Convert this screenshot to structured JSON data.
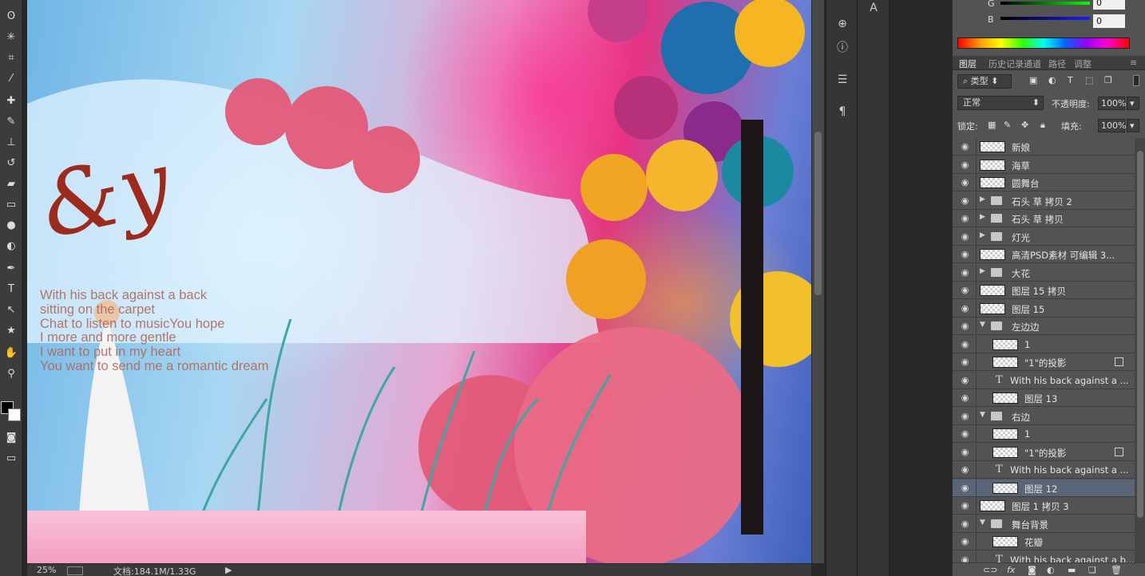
{
  "toolbar": {
    "tools": [
      {
        "name": "lasso-icon",
        "glyph": "ʘ"
      },
      {
        "name": "magic-wand-icon",
        "glyph": "✳"
      },
      {
        "name": "crop-icon",
        "glyph": "⌗"
      },
      {
        "name": "eyedropper-icon",
        "glyph": "⁄"
      },
      {
        "name": "healing-brush-icon",
        "glyph": "✚"
      },
      {
        "name": "brush-icon",
        "glyph": "✎"
      },
      {
        "name": "stamp-icon",
        "glyph": "⊥"
      },
      {
        "name": "history-brush-icon",
        "glyph": "↺"
      },
      {
        "name": "eraser-icon",
        "glyph": "▰"
      },
      {
        "name": "gradient-icon",
        "glyph": "▭"
      },
      {
        "name": "blur-icon",
        "glyph": "●"
      },
      {
        "name": "dodge-icon",
        "glyph": "◐"
      },
      {
        "name": "pen-icon",
        "glyph": "✒"
      },
      {
        "name": "type-icon",
        "glyph": "T"
      },
      {
        "name": "path-select-icon",
        "glyph": "↖"
      },
      {
        "name": "shape-icon",
        "glyph": "★"
      },
      {
        "name": "hand-icon",
        "glyph": "✋"
      },
      {
        "name": "zoom-icon",
        "glyph": "⚲"
      }
    ]
  },
  "canvas": {
    "script_text": "&y",
    "couple_text": [
      "With his back against a back",
      "sitting on the carpet",
      "Chat to listen to musicYou hope",
      " I more and more gentle",
      "I want to put in my heart",
      "You want to send me a romantic dream"
    ]
  },
  "status": {
    "zoom": "25%",
    "doc": "文档:184.1M/1.33G"
  },
  "color_panel": {
    "g_label": "G",
    "g_value": "0",
    "b_label": "B",
    "b_value": "0"
  },
  "panel_tabs": [
    "图层",
    "历史记录",
    "通道",
    "路径",
    "调整"
  ],
  "filter": {
    "kind_label": "类型"
  },
  "blend": {
    "mode": "正常",
    "opacity_label": "不透明度:",
    "opacity_value": "100%",
    "lock_label": "锁定:",
    "fill_label": "填充:",
    "fill_value": "100%"
  },
  "layers": [
    {
      "name": "新娘",
      "type": "pixel",
      "indent": 0
    },
    {
      "name": "海草",
      "type": "pixel",
      "indent": 0
    },
    {
      "name": "圆舞台",
      "type": "pixel",
      "indent": 0
    },
    {
      "name": "石头 草 拷贝 2",
      "type": "group-closed",
      "indent": 0
    },
    {
      "name": "石头 草 拷贝",
      "type": "group-closed",
      "indent": 0
    },
    {
      "name": "灯光",
      "type": "group-closed",
      "indent": 0
    },
    {
      "name": "高清PSD素材 可编辑 3...",
      "type": "pixel",
      "indent": 0
    },
    {
      "name": "大花",
      "type": "group-closed",
      "indent": 0
    },
    {
      "name": "图层 15 拷贝",
      "type": "pixel",
      "indent": 0
    },
    {
      "name": "图层 15",
      "type": "pixel",
      "indent": 0
    },
    {
      "name": "左边边",
      "type": "group-open",
      "indent": 0
    },
    {
      "name": "1",
      "type": "pixel",
      "indent": 1
    },
    {
      "name": "\"1\"的投影",
      "type": "pixel",
      "indent": 1,
      "fx": true
    },
    {
      "name": "With his back  against a ...",
      "type": "text",
      "indent": 1
    },
    {
      "name": "图层 13",
      "type": "pixel",
      "indent": 1
    },
    {
      "name": "右边",
      "type": "group-open",
      "indent": 0
    },
    {
      "name": "1",
      "type": "pixel",
      "indent": 1
    },
    {
      "name": "\"1\"的投影",
      "type": "pixel",
      "indent": 1,
      "fx": true
    },
    {
      "name": "With his back  against a ...",
      "type": "text",
      "indent": 1
    },
    {
      "name": "图层 12",
      "type": "pixel",
      "indent": 1,
      "selected": true
    },
    {
      "name": "图层 1 拷贝 3",
      "type": "pixel",
      "indent": 0
    },
    {
      "name": "舞台背景",
      "type": "group-open",
      "indent": 0
    },
    {
      "name": "花瓣",
      "type": "pixel",
      "indent": 1
    },
    {
      "name": "With his back  against a b...",
      "type": "text",
      "indent": 1
    }
  ],
  "bottom_icons": [
    "link-icon",
    "fx-icon",
    "mask-icon",
    "adjustment-icon",
    "folder-icon",
    "new-layer-icon",
    "trash-icon"
  ],
  "colors": {
    "selected_layer": "#596678",
    "panel_bg": "#535353",
    "accent_blue": "#1c1cff"
  }
}
